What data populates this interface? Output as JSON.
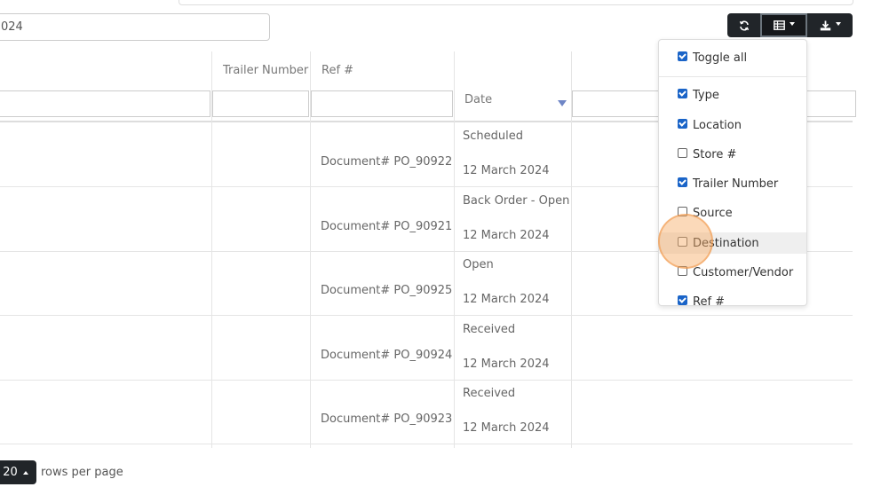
{
  "filters": {
    "date_value": "024"
  },
  "toolbar": {
    "refresh_icon": "refresh-icon",
    "columns_icon": "columns-icon",
    "export_icon": "download-icon"
  },
  "table": {
    "headers": [
      "Trailer Number",
      "Ref #",
      "Date"
    ],
    "rows": [
      {
        "ref": "Document# PO_90922",
        "status": "Scheduled",
        "date": "12 March 2024"
      },
      {
        "ref": "Document# PO_90921",
        "status": "Back Order - Open",
        "date": "12 March 2024"
      },
      {
        "ref": "Document# PO_90925",
        "status": "Open",
        "date": "12 March 2024"
      },
      {
        "ref": "Document# PO_90924",
        "status": "Received",
        "date": "12 March 2024"
      },
      {
        "ref": "Document# PO_90923",
        "status": "Received",
        "date": "12 March 2024"
      }
    ]
  },
  "column_menu": {
    "toggle_all": {
      "label": "Toggle all",
      "checked": true
    },
    "items": [
      {
        "label": "Type",
        "checked": true
      },
      {
        "label": "Location",
        "checked": true
      },
      {
        "label": "Store #",
        "checked": false
      },
      {
        "label": "Trailer Number",
        "checked": true
      },
      {
        "label": "Source",
        "checked": false
      },
      {
        "label": "Destination",
        "checked": false
      },
      {
        "label": "Customer/Vendor",
        "checked": false
      },
      {
        "label": "Ref #",
        "checked": true
      }
    ]
  },
  "pagination": {
    "page_size": "20",
    "label": "rows per page"
  }
}
